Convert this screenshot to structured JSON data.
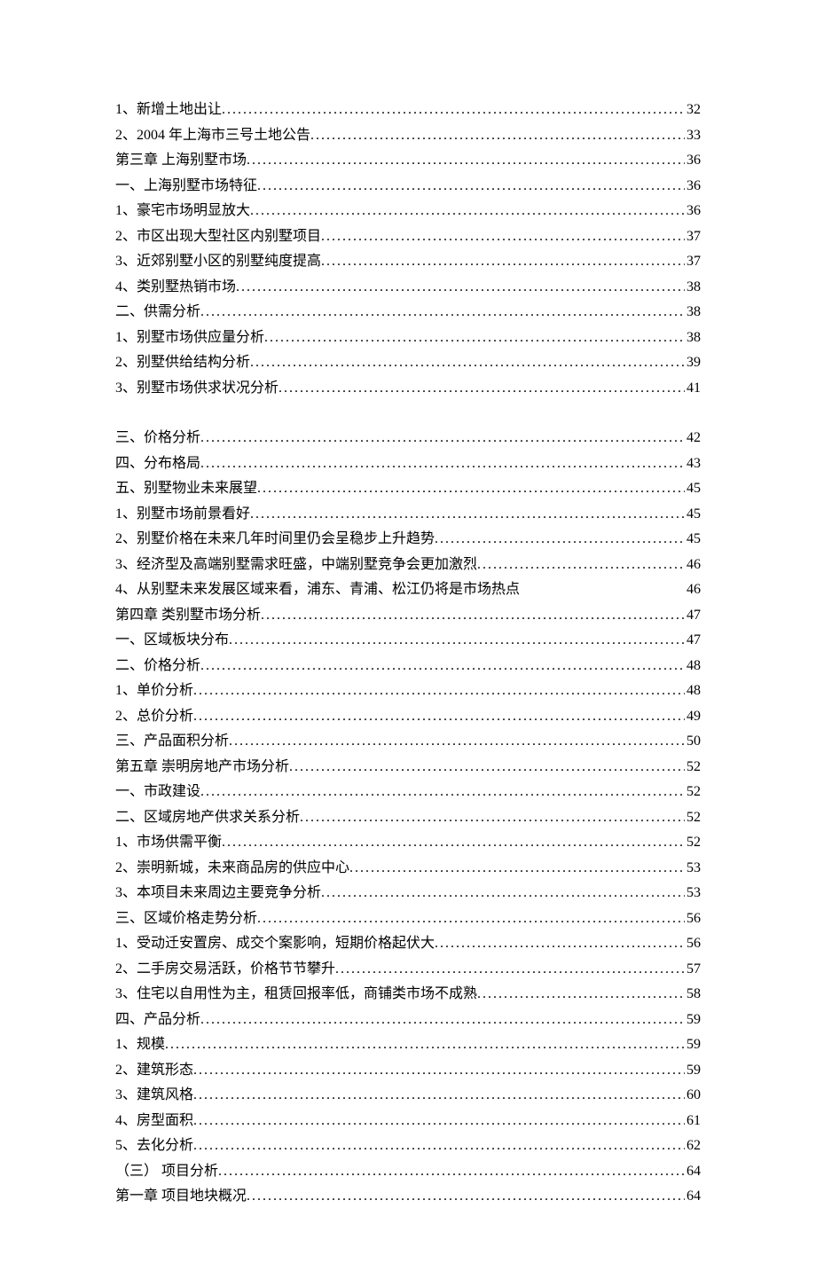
{
  "toc": [
    {
      "title": "1、新增土地出让",
      "page": "32",
      "full": false
    },
    {
      "title": "2、2004 年上海市三号土地公告",
      "page": "33",
      "full": false
    },
    {
      "title": "第三章   上海别墅市场",
      "page": "36",
      "full": false
    },
    {
      "title": "一、上海别墅市场特征",
      "page": "36",
      "full": false
    },
    {
      "title": "1、豪宅市场明显放大",
      "page": "36",
      "full": false
    },
    {
      "title": "2、市区出现大型社区内别墅项目",
      "page": "37",
      "full": false
    },
    {
      "title": "3、近郊别墅小区的别墅纯度提高",
      "page": "37",
      "full": false
    },
    {
      "title": "4、类别墅热销市场",
      "page": "38",
      "full": false
    },
    {
      "title": "二、供需分析",
      "page": "38",
      "full": false
    },
    {
      "title": "1、别墅市场供应量分析",
      "page": "38",
      "full": false
    },
    {
      "title": "2、别墅供给结构分析",
      "page": "39",
      "full": false
    },
    {
      "title": "3、别墅市场供求状况分析",
      "page": "41",
      "full": false
    },
    {
      "gap": true
    },
    {
      "title": "三、价格分析",
      "page": "42",
      "full": false
    },
    {
      "title": "四、分布格局",
      "page": "43",
      "full": false
    },
    {
      "title": "五、别墅物业未来展望",
      "page": "45",
      "full": false
    },
    {
      "title": "1、别墅市场前景看好",
      "page": "45",
      "full": false
    },
    {
      "title": "2、别墅价格在未来几年时间里仍会呈稳步上升趋势",
      "page": "45",
      "full": false
    },
    {
      "title": "3、经济型及高端别墅需求旺盛，中端别墅竞争会更加激烈",
      "page": "46",
      "full": false
    },
    {
      "title": "4、从别墅未来发展区域来看，浦东、青浦、松江仍将是市场热点",
      "page": "46",
      "full": true
    },
    {
      "title": "第四章   类别墅市场分析",
      "page": "47",
      "full": false
    },
    {
      "title": "一、区域板块分布",
      "page": "47",
      "full": false
    },
    {
      "title": "二、价格分析",
      "page": "48",
      "full": false
    },
    {
      "title": "1、单价分析",
      "page": "48",
      "full": false
    },
    {
      "title": "2、总价分析",
      "page": "49",
      "full": false
    },
    {
      "title": "三、产品面积分析",
      "page": "50",
      "full": false
    },
    {
      "title": "第五章   崇明房地产市场分析",
      "page": "52",
      "full": false
    },
    {
      "title": "一、市政建设",
      "page": "52",
      "full": false
    },
    {
      "title": "二、区域房地产供求关系分析",
      "page": "52",
      "full": false
    },
    {
      "title": "1、市场供需平衡",
      "page": "52",
      "full": false
    },
    {
      "title": "2、崇明新城，未来商品房的供应中心",
      "page": "53",
      "full": false
    },
    {
      "title": "3、本项目未来周边主要竞争分析",
      "page": "53",
      "full": false
    },
    {
      "title": "三、区域价格走势分析",
      "page": "56",
      "full": false
    },
    {
      "title": "1、受动迁安置房、成交个案影响，短期价格起伏大",
      "page": "56",
      "full": false
    },
    {
      "title": "2、二手房交易活跃，价格节节攀升",
      "page": "57",
      "full": false
    },
    {
      "title": "3、住宅以自用性为主，租赁回报率低，商铺类市场不成熟",
      "page": "58",
      "full": false
    },
    {
      "title": "四、产品分析",
      "page": "59",
      "full": false
    },
    {
      "title": "1、规模",
      "page": "59",
      "full": false
    },
    {
      "title": "2、建筑形态",
      "page": "59",
      "full": false
    },
    {
      "title": "3、建筑风格",
      "page": "60",
      "full": false
    },
    {
      "title": "4、房型面积",
      "page": "61",
      "full": false
    },
    {
      "title": "5、去化分析",
      "page": "62",
      "full": false
    },
    {
      "title": "（三）   项目分析 ",
      "page": "64",
      "full": false
    },
    {
      "title": "第一章  项目地块概况",
      "page": "64",
      "full": false
    }
  ]
}
